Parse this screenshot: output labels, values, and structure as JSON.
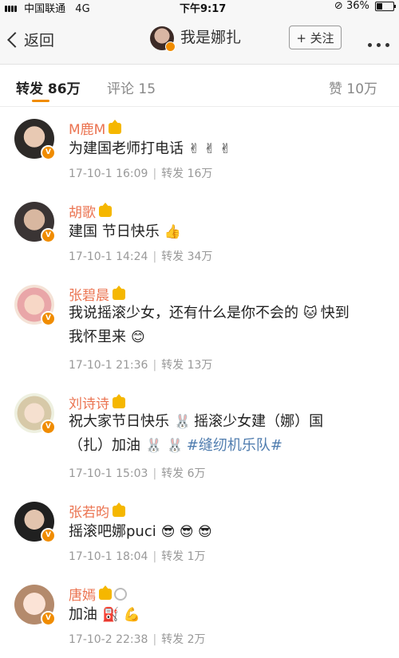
{
  "status": {
    "carrier": "中国联通",
    "network": "4G",
    "time": "下午9:17",
    "battery": "36%",
    "battery_level": 0.36
  },
  "nav": {
    "back_label": "返回",
    "title": "我是娜扎",
    "follow_label": "+ 关注"
  },
  "tabs": {
    "repost": "转发 86万",
    "comment": "评论 15",
    "like": "赞 10万"
  },
  "accent": "#f08c00",
  "items": [
    {
      "name": "M鹿M",
      "text": "为建国老师打电话",
      "emoji": "✌ ✌ ✌",
      "date": "17-10-1 16:09",
      "repost": "转发 16万"
    },
    {
      "name": "胡歌",
      "text": "建国 节日快乐",
      "emoji": "👍",
      "date": "17-10-1 14:24",
      "repost": "转发 34万"
    },
    {
      "name": "张碧晨",
      "text_line1": "我说摇滚少女，还有什么是你不会的",
      "emoji1": "🐱",
      "text_line1_tail": "快到",
      "text_line2": "我怀里来",
      "emoji2": "😊",
      "date": "17-10-1 21:36",
      "repost": "转发 13万"
    },
    {
      "name": "刘诗诗",
      "text_line1": "祝大家节日快乐",
      "emoji1": "🐰",
      "text_line1_tail": "摇滚少女建（娜）国",
      "text_line2": "（扎）加油",
      "emoji2": "🐰 🐰",
      "hashtag": "#缝纫机乐队#",
      "date": "17-10-1 15:03",
      "repost": "转发 6万"
    },
    {
      "name": "张若昀",
      "text": "摇滚吧娜puci",
      "emoji": "😎 😎 😎",
      "date": "17-10-1 18:04",
      "repost": "转发 1万"
    },
    {
      "name": "唐嫣",
      "text": "加油",
      "emoji": "⛽ 💪",
      "date": "17-10-2 22:38",
      "repost": "转发 2万"
    }
  ]
}
